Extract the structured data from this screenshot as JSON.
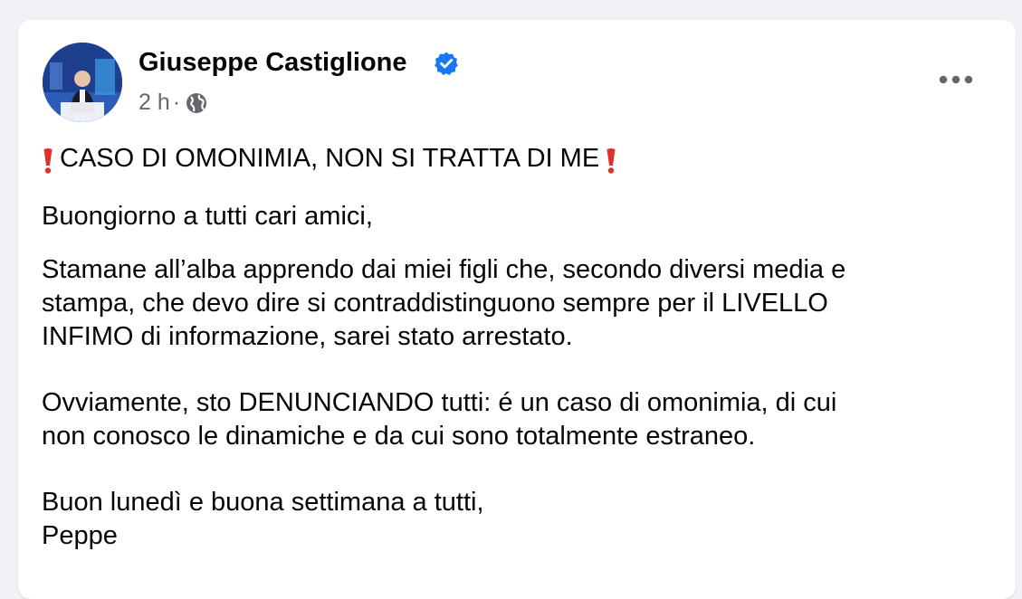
{
  "post": {
    "author": {
      "name": "Giuseppe Castiglione",
      "verified": true,
      "avatar_icon": "profile-photo"
    },
    "meta": {
      "time": "2 h",
      "separator": "·",
      "audience_icon": "globe-icon"
    },
    "more_icon": "more-horizontal-icon",
    "title": "CASO DI OMONIMIA, NON SI TRATTA DI ME",
    "title_marker_icon": "red-exclamation-icon",
    "greeting": "Buongiorno a tutti cari amici,",
    "paragraph_main": [
      "Stamane all’alba apprendo dai miei figli che, secondo diversi media e",
      "stampa, che devo dire si contraddistinguono sempre per il LIVELLO",
      "INFIMO di informazione, sarei stato arrestato."
    ],
    "paragraph_denounce": [
      "Ovviamente, sto DENUNCIANDO tutti: é un caso di omonimia, di cui",
      "non conosco le dinamiche e da cui sono totalmente estraneo."
    ],
    "closing": [
      "Buon lunedì e buona settimana a tutti,",
      "Peppe"
    ]
  },
  "colors": {
    "page_bg": "#f0f2f5",
    "card_bg": "#ffffff",
    "text_primary": "#050505",
    "text_secondary": "#65676b",
    "verified_blue": "#1877f2",
    "exclaim_red": "#e0302d"
  }
}
